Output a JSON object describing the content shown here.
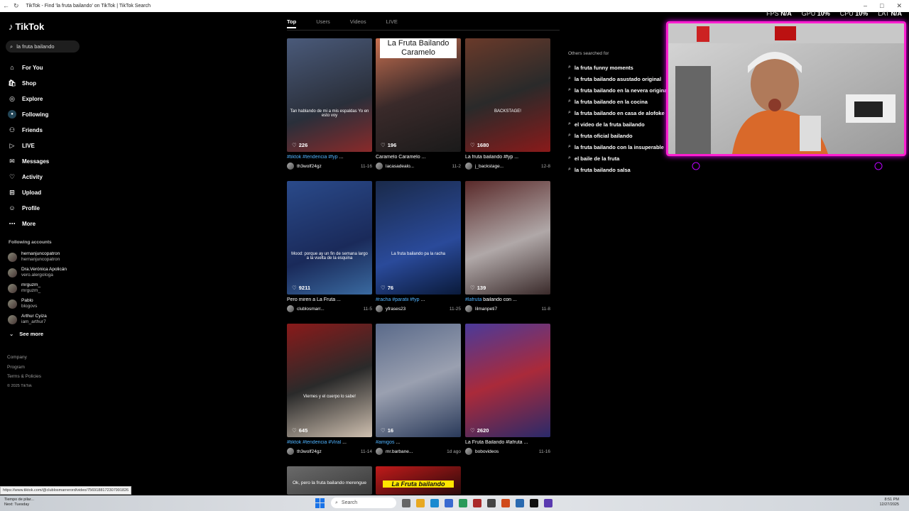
{
  "browser": {
    "tab_title": "TikTok - Find 'la fruta bailando' on TikTok | TikTok Search"
  },
  "perf": [
    {
      "label": "FPS",
      "value": "N/A"
    },
    {
      "label": "GPU",
      "value": "10%"
    },
    {
      "label": "CPU",
      "value": "10%"
    },
    {
      "label": "LAT",
      "value": "N/A"
    }
  ],
  "sidebar": {
    "logo": "TikTok",
    "search_value": "la fruta bailando",
    "nav": [
      {
        "label": "For You",
        "icon": "home-icon"
      },
      {
        "label": "Shop",
        "icon": "shop-icon"
      },
      {
        "label": "Explore",
        "icon": "compass-icon"
      },
      {
        "label": "Following",
        "icon": "following-icon"
      },
      {
        "label": "Friends",
        "icon": "friends-icon"
      },
      {
        "label": "LIVE",
        "icon": "live-icon"
      },
      {
        "label": "Messages",
        "icon": "messages-icon"
      },
      {
        "label": "Activity",
        "icon": "activity-icon"
      },
      {
        "label": "Upload",
        "icon": "upload-icon"
      },
      {
        "label": "Profile",
        "icon": "profile-icon"
      },
      {
        "label": "More",
        "icon": "more-icon"
      }
    ],
    "following_header": "Following accounts",
    "accounts": [
      {
        "name": "hernanjuncopatron",
        "user": "hernanjuncopatron"
      },
      {
        "name": "Dra.Verónica Apolicán",
        "user": "vero.alergologa"
      },
      {
        "name": "mrguzm_",
        "user": "mrguzm_"
      },
      {
        "name": "Pablo",
        "user": "blogovs"
      },
      {
        "name": "Arthur Cyiza",
        "user": "iam_arthur7"
      }
    ],
    "see_more": "See more",
    "footer": [
      "Company",
      "Program",
      "Terms & Policies"
    ],
    "copyright": "© 2025 TikTok"
  },
  "tabs": [
    "Top",
    "Users",
    "Videos",
    "LIVE"
  ],
  "videos": [
    {
      "likes": "226",
      "overlay": "Tan hablando de mi a mis espaldas Yo en esto voy",
      "tag": "#tiktok #tendencia #fyp",
      "text": " ...",
      "author": "th3wolf24gz",
      "date": "11-16",
      "bg": "linear-gradient(160deg,#4a5a7a,#2a2f3a 60%,#8a2a2a)"
    },
    {
      "likes": "196",
      "banner": "La Fruta Bailando Caramelo",
      "tag": "",
      "text": "Caramelo Caramelo ...",
      "author": "lacasadealo...",
      "date": "11-2",
      "bg": "linear-gradient(160deg,#c87050,#3a2a2a 50%,#1a1a1a)"
    },
    {
      "likes": "1680",
      "overlay": "BACKSTAGE!",
      "tag": "",
      "text": "La fruta bailando #fyp ...",
      "author": "j_backstage...",
      "date": "12-8",
      "bg": "linear-gradient(160deg,#6a3a2a,#2a2a2a 50%,#8a1a1a)"
    },
    {
      "likes": "9211",
      "overlay": "Mood: porque ay un fin de semana largo a la vuelta de la esquina",
      "tag": "",
      "text": "Pero miren a La Fruta ...",
      "author": "clublosmarr...",
      "date": "11-5",
      "bg": "linear-gradient(160deg,#2a4a8a,#1a2a5a 60%,#3a6aa0)"
    },
    {
      "likes": "76",
      "overlay": "La fruta bailando pa la racha",
      "tag": "#racha #paratii #fyp",
      "text": " ...",
      "author": "yfrases23",
      "date": "11-25",
      "bg": "linear-gradient(160deg,#1a2a4a,#2a4a9a 60%,#0a1a3a)"
    },
    {
      "likes": "139",
      "overlay": "",
      "tag": "#lafruta",
      "text": " bailando con ...",
      "author": "lilmanpeti7",
      "date": "11-8",
      "bg": "linear-gradient(160deg,#5a2a2a,#b0a8a8 55%,#3a2a2a)"
    },
    {
      "likes": "645",
      "overlay": "Viernes y el cuerpo lo sabe!",
      "tag": "#tiktok #tendencia #Viral",
      "text": " ...",
      "author": "th3wolf24gz",
      "date": "11-14",
      "bg": "linear-gradient(160deg,#8a1a1a,#2a2a2a 50%,#cfc0b0)"
    },
    {
      "likes": "16",
      "overlay": "",
      "tag": "#amigos",
      "text": " ...",
      "author": "mr.barbane...",
      "date": "1d ago",
      "bg": "linear-gradient(160deg,#5a6a8a,#9aa0b0 50%,#2a3a5a)"
    },
    {
      "likes": "2620",
      "overlay": "",
      "tag": "",
      "text": "La Fruta Bailando #lafruta ...",
      "author": "bobovideos",
      "date": "11-16",
      "bg": "linear-gradient(160deg,#4a3a9a,#aa2a3a 50%,#2a2a6a)"
    }
  ],
  "partial_videos": [
    {
      "overlay": "Ok, pero la fruta bailando merengue",
      "bg": "linear-gradient(160deg,#6a6a6a,#3a3a3a)"
    },
    {
      "overlay": "La Fruta bailando",
      "bg": "linear-gradient(160deg,#c01a1a,#2a0a0a)"
    }
  ],
  "related": {
    "header": "Others searched for",
    "items": [
      "la fruta funny moments",
      "la fruta bailando asustado original",
      "la fruta bailando en la nevera original",
      "la fruta bailando en la cocina",
      "la fruta bailando en casa de alofoke",
      "el video de la fruta bailando",
      "la fruta oficial bailando",
      "la fruta bailando con la insuperable",
      "el baile de la fruta",
      "la fruta bailando salsa"
    ]
  },
  "status_url": "https://www.tiktok.com/@clublosmarrerord/video/7569188172307991826",
  "taskbar": {
    "search_label": "Search",
    "notice_line1": "Tiempo de pilar...",
    "notice_line2": "Next: Tuesday",
    "time": "8:51 PM",
    "date": "12/27/2025"
  }
}
